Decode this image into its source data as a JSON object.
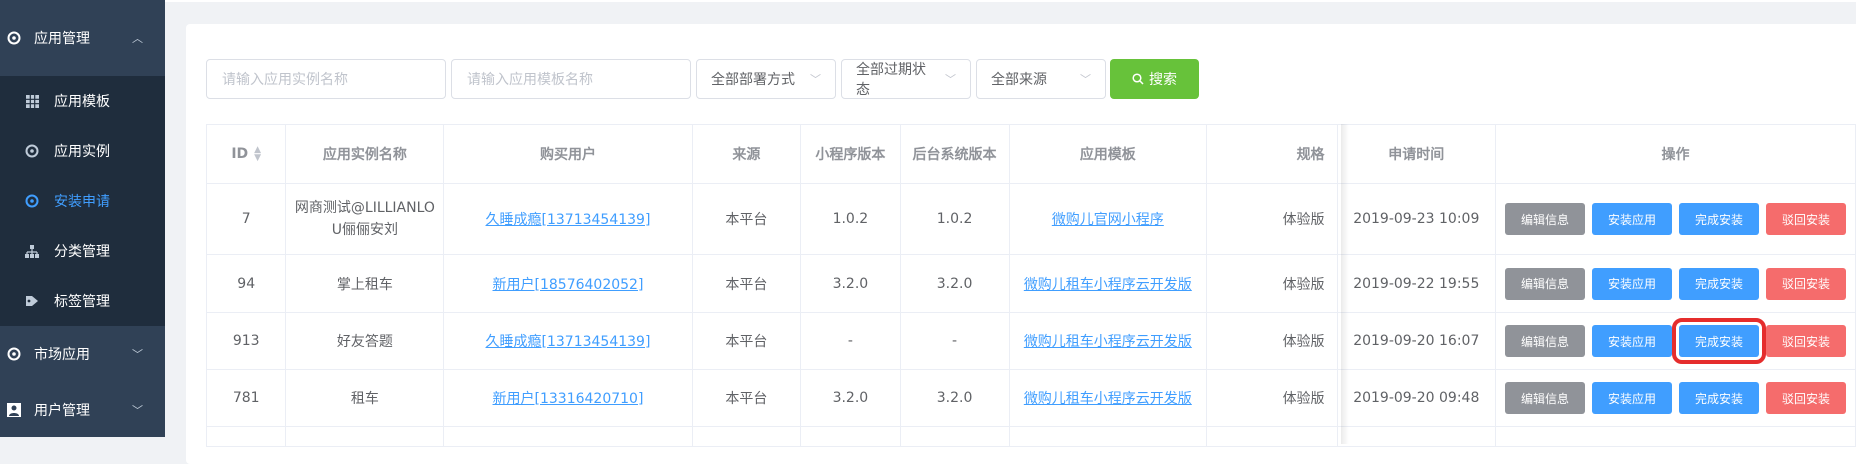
{
  "sidebar": {
    "groups": [
      {
        "label": "应用管理",
        "icon": "app-gear-icon",
        "chev": "︿"
      },
      {
        "label": "市场应用",
        "icon": "market-gear-icon",
        "chev": "﹀"
      },
      {
        "label": "用户管理",
        "icon": "user-card-icon",
        "chev": "﹀"
      }
    ],
    "items": [
      {
        "label": "应用模板",
        "icon": "grid-icon"
      },
      {
        "label": "应用实例",
        "icon": "gear-icon"
      },
      {
        "label": "安装申请",
        "icon": "gear-icon"
      },
      {
        "label": "分类管理",
        "icon": "hierarchy-icon"
      },
      {
        "label": "标签管理",
        "icon": "tag-icon"
      }
    ]
  },
  "filters": {
    "instance_placeholder": "请输入应用实例名称",
    "template_placeholder": "请输入应用模板名称",
    "deploy": "全部部署方式",
    "expire": "全部过期状态",
    "source": "全部来源",
    "search": "搜索"
  },
  "table": {
    "headers": [
      "ID",
      "应用实例名称",
      "购买用户",
      "来源",
      "小程序版本",
      "后台系统版本",
      "应用模板",
      "规格",
      "申请时间",
      "操作"
    ],
    "rows": [
      {
        "id": "7",
        "name": "网商测试@LILLIANLOU俪俪安刘",
        "user": "久睡成瘾[13713454139]",
        "source": "本平台",
        "mini": "1.0.2",
        "backend": "1.0.2",
        "template": "微购儿官网小程序",
        "spec": "体验版",
        "time": "2019-09-23 10:09"
      },
      {
        "id": "94",
        "name": "掌上租车",
        "user": "新用户[18576402052]",
        "source": "本平台",
        "mini": "3.2.0",
        "backend": "3.2.0",
        "template": "微购儿租车小程序云开发版",
        "spec": "体验版",
        "time": "2019-09-22 19:55"
      },
      {
        "id": "913",
        "name": "好友答题",
        "user": "久睡成瘾[13713454139]",
        "source": "本平台",
        "mini": "-",
        "backend": "-",
        "template": "微购儿租车小程序云开发版",
        "spec": "体验版",
        "time": "2019-09-20 16:07"
      },
      {
        "id": "781",
        "name": "租车",
        "user": "新用户[13316420710]",
        "source": "本平台",
        "mini": "3.2.0",
        "backend": "3.2.0",
        "template": "微购儿租车小程序云开发版",
        "spec": "体验版",
        "time": "2019-09-20 09:48"
      }
    ],
    "ops": {
      "edit": "编辑信息",
      "install": "安装应用",
      "done": "完成安装",
      "reject": "驳回安装"
    }
  },
  "colors": {
    "sidebar": "#304156",
    "active": "#409eff",
    "search": "#67c23a",
    "highlight": "#e52d2d"
  }
}
